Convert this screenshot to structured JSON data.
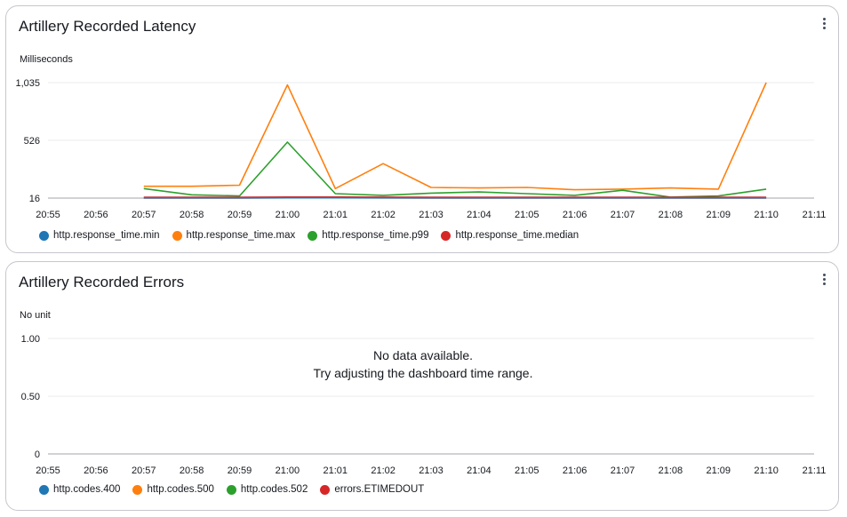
{
  "widgets": [
    {
      "title": "Artillery Recorded Latency",
      "unit": "Milliseconds",
      "legend": [
        {
          "label": "http.response_time.min",
          "color": "#1f77b4"
        },
        {
          "label": "http.response_time.max",
          "color": "#ff7f0e"
        },
        {
          "label": "http.response_time.p99",
          "color": "#2ca02c"
        },
        {
          "label": "http.response_time.median",
          "color": "#d62728"
        }
      ]
    },
    {
      "title": "Artillery Recorded Errors",
      "unit": "No unit",
      "no_data_line1": "No data available.",
      "no_data_line2": "Try adjusting the dashboard time range.",
      "legend": [
        {
          "label": "http.codes.400",
          "color": "#1f77b4"
        },
        {
          "label": "http.codes.500",
          "color": "#ff7f0e"
        },
        {
          "label": "http.codes.502",
          "color": "#2ca02c"
        },
        {
          "label": "errors.ETIMEDOUT",
          "color": "#d62728"
        }
      ]
    }
  ],
  "chart_data": [
    {
      "type": "line",
      "title": "Artillery Recorded Latency",
      "ylabel": "Milliseconds",
      "x": [
        "20:55",
        "20:56",
        "20:57",
        "20:58",
        "20:59",
        "21:00",
        "21:01",
        "21:02",
        "21:03",
        "21:04",
        "21:05",
        "21:06",
        "21:07",
        "21:08",
        "21:09",
        "21:10",
        "21:11"
      ],
      "yticks": [
        16,
        526,
        1035
      ],
      "ytick_labels": [
        "16",
        "526",
        "1,035"
      ],
      "ylim": [
        16,
        1035
      ],
      "grid": true,
      "legend_position": "bottom",
      "series": [
        {
          "name": "http.response_time.min",
          "color": "#1f77b4",
          "values": [
            null,
            null,
            18,
            18,
            18,
            18,
            18,
            18,
            18,
            18,
            18,
            18,
            18,
            18,
            18,
            18,
            null
          ]
        },
        {
          "name": "http.response_time.max",
          "color": "#ff7f0e",
          "values": [
            null,
            null,
            120,
            120,
            130,
            1015,
            100,
            320,
            110,
            105,
            110,
            90,
            95,
            105,
            95,
            1035,
            null
          ]
        },
        {
          "name": "http.response_time.p99",
          "color": "#2ca02c",
          "values": [
            null,
            null,
            100,
            45,
            35,
            510,
            55,
            40,
            60,
            70,
            55,
            40,
            85,
            25,
            35,
            95,
            null
          ]
        },
        {
          "name": "http.response_time.median",
          "color": "#d62728",
          "values": [
            null,
            null,
            20,
            20,
            20,
            22,
            22,
            21,
            20,
            20,
            20,
            20,
            20,
            20,
            20,
            20,
            null
          ]
        }
      ]
    },
    {
      "type": "line",
      "title": "Artillery Recorded Errors",
      "ylabel": "No unit",
      "x": [
        "20:55",
        "20:56",
        "20:57",
        "20:58",
        "20:59",
        "21:00",
        "21:01",
        "21:02",
        "21:03",
        "21:04",
        "21:05",
        "21:06",
        "21:07",
        "21:08",
        "21:09",
        "21:10",
        "21:11"
      ],
      "yticks": [
        0,
        0.5,
        1.0
      ],
      "ytick_labels": [
        "0",
        "0.50",
        "1.00"
      ],
      "ylim": [
        0,
        1
      ],
      "grid": true,
      "legend_position": "bottom",
      "series": [
        {
          "name": "http.codes.400",
          "color": "#1f77b4",
          "values": []
        },
        {
          "name": "http.codes.500",
          "color": "#ff7f0e",
          "values": []
        },
        {
          "name": "http.codes.502",
          "color": "#2ca02c",
          "values": []
        },
        {
          "name": "errors.ETIMEDOUT",
          "color": "#d62728",
          "values": []
        }
      ]
    }
  ]
}
